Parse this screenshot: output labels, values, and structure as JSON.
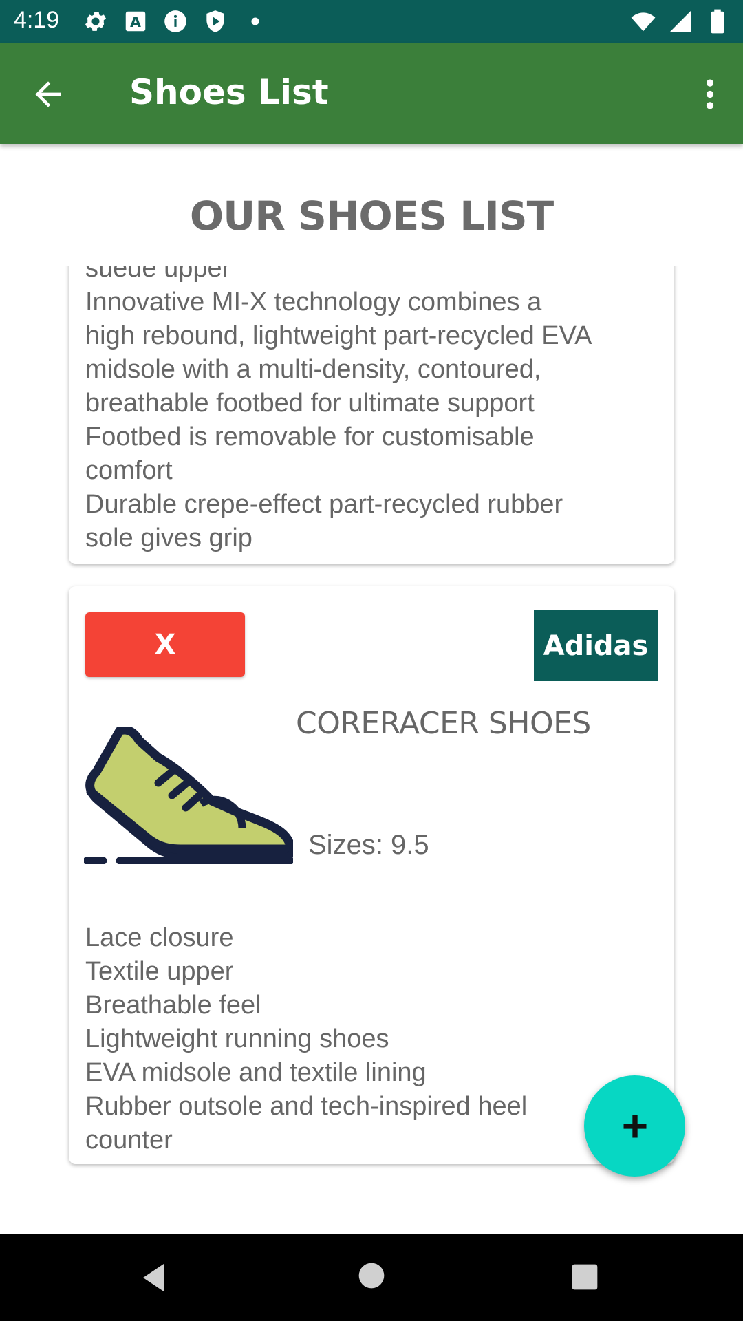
{
  "status_bar": {
    "time": "4:19",
    "icons": [
      "gear-icon",
      "text-a-icon",
      "info-icon",
      "shield-play-icon",
      "dot-icon",
      "wifi-icon",
      "signal-icon",
      "battery-icon"
    ]
  },
  "app_bar": {
    "title": "Shoes List",
    "background": "#3b7f3a"
  },
  "page": {
    "heading": "OUR SHOES LIST"
  },
  "shoes": [
    {
      "description_lines": [
        "suede upper",
        "Innovative MI-X technology combines a",
        "high rebound, lightweight part-recycled EVA",
        "midsole with a multi-density, contoured,",
        "breathable footbed for ultimate support",
        "Footbed is removable for customisable",
        "comfort",
        "Durable crepe-effect part-recycled rubber",
        "sole gives grip"
      ]
    },
    {
      "remove_label": "X",
      "brand": "Adidas",
      "name": "CORERACER SHOES",
      "sizes": "Sizes: 9.5",
      "description_lines": [
        "Lace closure",
        "Textile upper",
        "Breathable feel",
        "Lightweight running shoes",
        "EVA midsole and textile lining",
        "Rubber outsole and tech-inspired heel",
        "counter"
      ]
    }
  ],
  "colors": {
    "remove_button": "#f44336",
    "brand_badge": "#0b5d58",
    "fab": "#07d7c3",
    "status_bar": "#0b5d58"
  },
  "fab": {
    "icon": "plus-icon"
  }
}
